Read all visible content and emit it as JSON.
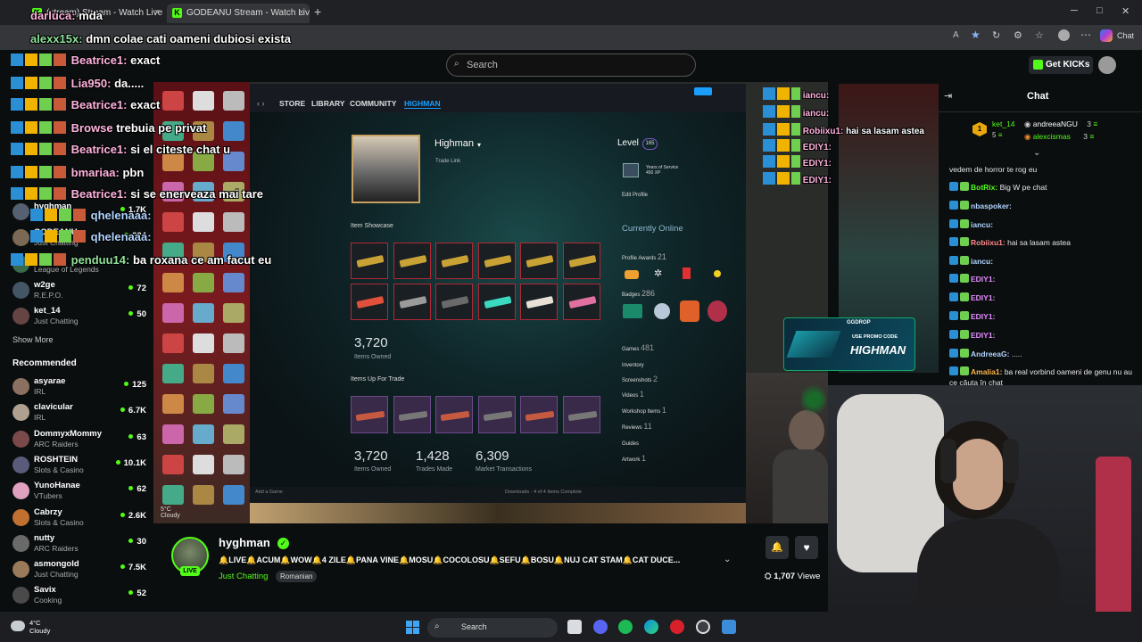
{
  "browser": {
    "tabs": [
      {
        "label": "(stream) Stream - Watch Live"
      },
      {
        "label": "GODEANU Stream - Watch Live on"
      }
    ],
    "new_tab_symbol": "+",
    "tab_close_symbol": "×"
  },
  "kick": {
    "search_placeholder": "Search",
    "get_kicks_label": "Get KICKs",
    "chat_title": "Chat"
  },
  "sidebar": {
    "following": [
      {
        "name": "hyghman",
        "category": "",
        "viewers": "1.7K",
        "color": "#556070"
      },
      {
        "name": "GODEANU",
        "category": "Just Chatting",
        "viewers": "224",
        "color": "#7a6a55"
      },
      {
        "name": "",
        "category": "League of Legends",
        "viewers": "",
        "color": "#3a6a4a"
      },
      {
        "name": "w2ge",
        "category": "R.E.P.O.",
        "viewers": "72",
        "color": "#445566"
      },
      {
        "name": "ket_14",
        "category": "Just Chatting",
        "viewers": "50",
        "color": "#664444"
      }
    ],
    "show_more": "Show More",
    "recommended_title": "Recommended",
    "recommended": [
      {
        "name": "asyarae",
        "category": "IRL",
        "viewers": "125",
        "color": "#8a7060"
      },
      {
        "name": "clavicular",
        "category": "IRL",
        "viewers": "6.7K",
        "color": "#b0a090"
      },
      {
        "name": "DommyxMommy",
        "category": "ARC Raiders",
        "viewers": "63",
        "color": "#7a4a4a"
      },
      {
        "name": "ROSHTEIN",
        "category": "Slots & Casino",
        "viewers": "10.1K",
        "color": "#5a5a7a"
      },
      {
        "name": "YunoHanae",
        "category": "VTubers",
        "viewers": "62",
        "color": "#e0a0c0"
      },
      {
        "name": "Cabrzy",
        "category": "Slots & Casino",
        "viewers": "2.6K",
        "color": "#c07030"
      },
      {
        "name": "nutty",
        "category": "ARC Raiders",
        "viewers": "30",
        "color": "#6a6a6a"
      },
      {
        "name": "asmongold",
        "category": "Just Chatting",
        "viewers": "7.5K",
        "color": "#9a7a5a"
      },
      {
        "name": "Savix",
        "category": "Cooking",
        "viewers": "52",
        "color": "#4a4a4a"
      }
    ]
  },
  "overlay_chat": [
    {
      "user": "darluca:",
      "text": "mda",
      "cls": ""
    },
    {
      "user": "alexx15x:",
      "text": "dmn colae cati oameni dubiosi exista",
      "cls": "green"
    },
    {
      "user": "Beatrice1:",
      "text": "exact",
      "cls": ""
    },
    {
      "user": "Lia950:",
      "text": "da.....",
      "cls": ""
    },
    {
      "user": "Beatrice1:",
      "text": "exact",
      "cls": ""
    },
    {
      "user": "Browse",
      "text": "trebuia pe privat",
      "cls": ""
    },
    {
      "user": "Beatrice1:",
      "text": "si el citeste chat u",
      "cls": ""
    },
    {
      "user": "bmariaa:",
      "text": "pbn",
      "cls": ""
    },
    {
      "user": "Beatrice1:",
      "text": "si se enerveaza mai tare",
      "cls": ""
    },
    {
      "user": "qhelenaaa:",
      "text": "",
      "cls": "blue"
    },
    {
      "user": "qhelenaaa:",
      "text": "",
      "cls": "blue"
    },
    {
      "user": "penduu14:",
      "text": "ba roxana ce am facut eu",
      "cls": "green"
    }
  ],
  "steam": {
    "nav": [
      "STORE",
      "LIBRARY",
      "COMMUNITY",
      "HIGHMAN"
    ],
    "profile_name": "Highman",
    "trade_link": "Trade Link",
    "level_label": "Level",
    "level_value": "165",
    "years_of_service": "Years of Service",
    "years_xp": "450 XP",
    "edit_profile": "Edit Profile",
    "currently_online": "Currently Online",
    "item_showcase": "Item Showcase",
    "items_owned_value": "3,720",
    "items_owned_label": "Items Owned",
    "items_up_for_trade": "Items Up For Trade",
    "stats": [
      {
        "value": "3,720",
        "label": "Items Owned"
      },
      {
        "value": "1,428",
        "label": "Trades Made"
      },
      {
        "value": "6,309",
        "label": "Market Transactions"
      }
    ],
    "profile_awards_label": "Profile Awards",
    "profile_awards_count": "21",
    "badges_label": "Badges",
    "badges_count": "286",
    "side_links": [
      {
        "label": "Games",
        "count": "481"
      },
      {
        "label": "Inventory",
        "count": ""
      },
      {
        "label": "Screenshots",
        "count": "2"
      },
      {
        "label": "Videos",
        "count": "1"
      },
      {
        "label": "Workshop Items",
        "count": "1"
      },
      {
        "label": "Reviews",
        "count": "11"
      },
      {
        "label": "Guides",
        "count": ""
      },
      {
        "label": "Artwork",
        "count": "1"
      }
    ],
    "add_game": "Add a Game",
    "downloads": "Downloads - 4 of 4 Items Complete"
  },
  "desktop_weather": {
    "temp": "5°C",
    "cond": "Cloudy"
  },
  "right_overlay_chat": [
    {
      "user": "iancu:",
      "text": ""
    },
    {
      "user": "iancu:",
      "text": ""
    },
    {
      "user": "Robiixu1:",
      "text": "hai sa lasam astea"
    },
    {
      "user": "EDIY1:",
      "text": ""
    },
    {
      "user": "EDIY1:",
      "text": ""
    },
    {
      "user": "EDIY1:",
      "text": ""
    }
  ],
  "gg_ad": {
    "brand": "GGDROP",
    "promo": "USE PROMO CODE",
    "code": "HIGHMAN"
  },
  "chat": {
    "leaderboard": [
      {
        "rank": "1",
        "user": "ket_14",
        "points": "5"
      },
      {
        "rank": "",
        "user": "andreeaNGU",
        "points": "3"
      },
      {
        "rank": "",
        "user": "alexcismas",
        "points": "3"
      }
    ],
    "messages": [
      {
        "user": "",
        "text": "vedem de horror te rog eu",
        "color": "#ffffff"
      },
      {
        "user": "BotRix:",
        "text": "Big W pe chat",
        "color": "#53fc18"
      },
      {
        "user": "nbaspoker:",
        "text": "",
        "color": "#b0d4ff"
      },
      {
        "user": "iancu:",
        "text": "",
        "color": "#b0d4ff"
      },
      {
        "user": "Robiixu1:",
        "text": "hai sa lasam astea",
        "color": "#ff8a8a"
      },
      {
        "user": "iancu:",
        "text": "",
        "color": "#b0d4ff"
      },
      {
        "user": "EDIY1:",
        "text": "",
        "color": "#e58cff"
      },
      {
        "user": "EDIY1:",
        "text": "",
        "color": "#e58cff"
      },
      {
        "user": "EDIY1:",
        "text": "",
        "color": "#e58cff"
      },
      {
        "user": "EDIY1:",
        "text": "",
        "color": "#e58cff"
      },
      {
        "user": "AndreeaG:",
        "text": ".....",
        "color": "#b0d4ff"
      },
      {
        "user": "Amalia1:",
        "text": "ba real vorbind oameni de genu nu au ce căuta în chat",
        "color": "#ffb347"
      }
    ]
  },
  "stream_info": {
    "streamer": "hyghman",
    "live_badge": "LIVE",
    "title": "🔔LIVE🔔ACUM🔔WOW🔔4 ZILE🔔PANA VINE🔔MOSU🔔COCOLOSU🔔SEFU🔔BOSU🔔NUJ CAT STAM🔔CAT DUCE...",
    "category": "Just Chatting",
    "tag": "Romanian",
    "viewers": "1,707",
    "viewers_suffix": "Viewe"
  },
  "taskbar": {
    "weather_temp": "4°C",
    "weather_cond": "Cloudy",
    "search_label": "Search"
  }
}
